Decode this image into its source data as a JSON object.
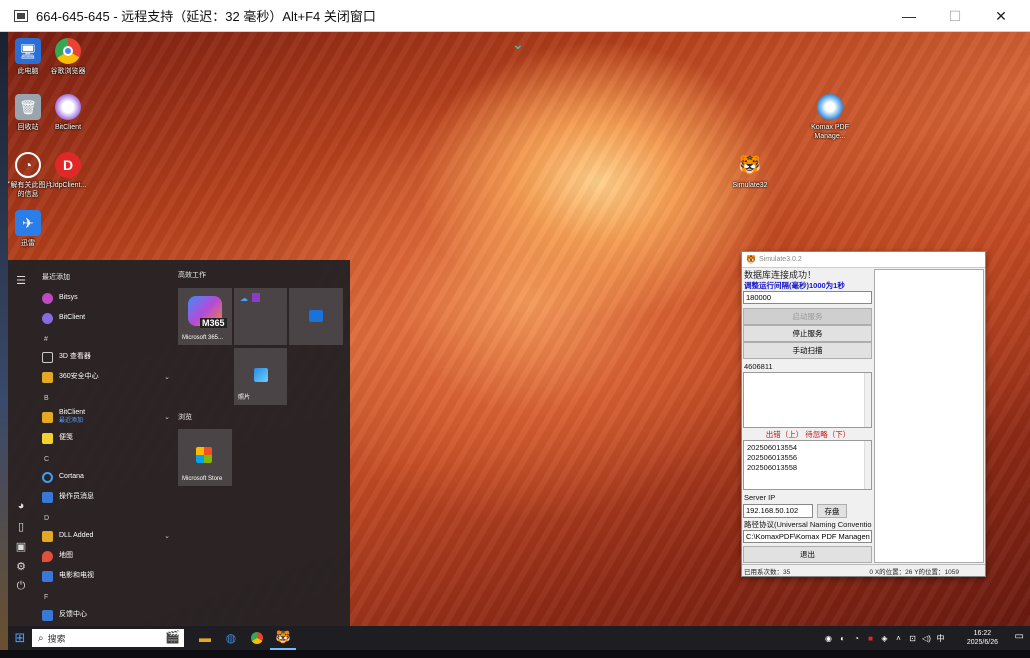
{
  "remote_window": {
    "title": "664-645-645 - 远程支持（延迟：32 毫秒）Alt+F4 关闭窗口",
    "minimize": "—",
    "maximize": "☐",
    "close": "✕"
  },
  "desktop": {
    "icons": [
      {
        "label": "此电脑",
        "icon": "computer-icon"
      },
      {
        "label": "谷歌浏览器",
        "icon": "chrome-icon"
      },
      {
        "label": "回收站",
        "icon": "recycle-bin-icon"
      },
      {
        "label": "BitClient",
        "icon": "bitclient-icon"
      },
      {
        "label": "了解有关此图片的信息",
        "icon": "info-icon"
      },
      {
        "label": "UdpClient...",
        "icon": "udpclient-icon"
      },
      {
        "label": "迅雷",
        "icon": "thunder-icon"
      },
      {
        "label": "Komax PDF Manage...",
        "icon": "pdf-icon"
      },
      {
        "label": "Simulate32",
        "icon": "simulate-icon"
      }
    ]
  },
  "start_menu": {
    "recent_header": "最近添加",
    "apps": [
      {
        "letter": "",
        "name": "Bitsys",
        "color": "#c04ac0"
      },
      {
        "letter": "",
        "name": "BitClient",
        "color": "#8a6adf"
      },
      {
        "letter": "#",
        "name": "3D 查看器",
        "color": "#888"
      },
      {
        "letter": "",
        "name": "360安全中心",
        "color": "#e3a826",
        "expand": "⌄"
      },
      {
        "letter": "B",
        "name": "BitClient",
        "sub": "最近添加",
        "color": "#e3a826",
        "expand": "⌄"
      },
      {
        "letter": "",
        "name": "便笺",
        "color": "#f2d230"
      },
      {
        "letter": "C",
        "name": "Cortana",
        "color": "#3aa0ff"
      },
      {
        "letter": "",
        "name": "操作员消息",
        "color": "#3a78d8"
      },
      {
        "letter": "D",
        "name": "DLL Added",
        "color": "#e3a826",
        "expand": "⌄"
      },
      {
        "letter": "",
        "name": "地图",
        "color": "#e0503a"
      },
      {
        "letter": "",
        "name": "电影和电视",
        "color": "#3a78d8"
      },
      {
        "letter": "F",
        "name": "反馈中心",
        "color": "#3a78d8"
      }
    ],
    "tiles_header_1": "高效工作",
    "tiles_header_2": "浏览",
    "tiles": {
      "m365_label": "Microsoft 365...",
      "m365_badge": "M365",
      "photos_label": "照片",
      "store_label": "Microsoft Store"
    }
  },
  "taskbar": {
    "search_placeholder": "搜索",
    "time": "16:22",
    "date": "2025/6/26",
    "ime": "中"
  },
  "simulate": {
    "title": "Simulate3.0.2",
    "status": "数据库连接成功！",
    "interval_note": "调整运行间隔(毫秒)1000为1秒",
    "interval_value": "180000",
    "start_btn": "启动服务",
    "stop_btn": "停止服务",
    "manual_btn": "手动扫描",
    "count_value": "4606811",
    "list_header": "出错（上） 待忽略（下）",
    "list_items": [
      "202506013554",
      "202506013556",
      "202506013558"
    ],
    "server_ip_label": "Server IP",
    "server_ip": "192.168.50.102",
    "save_btn": "存盘",
    "path_label": "路径协议(Universal Naming Conventio",
    "path_value": "C:\\KomaxPDF\\Komax PDF Managen",
    "exit_btn": "退出",
    "status_left": "已用系次数：35",
    "status_right": "0 X的位置：26 Y的位置：1059"
  }
}
